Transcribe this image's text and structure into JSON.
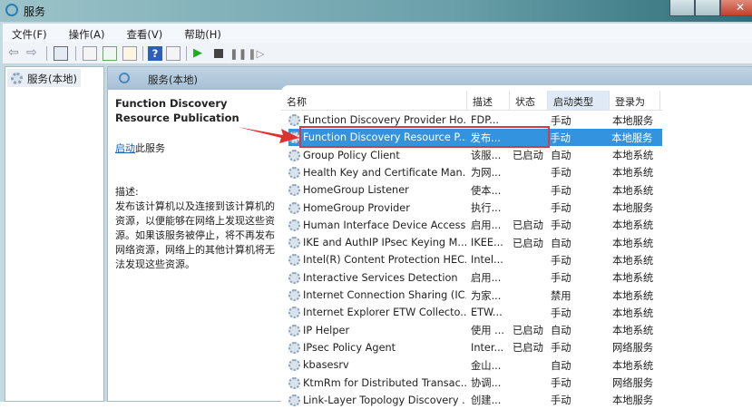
{
  "window": {
    "title": "服务",
    "close": "✕"
  },
  "menu": [
    "文件(F)",
    "操作(A)",
    "查看(V)",
    "帮助(H)"
  ],
  "tree": {
    "root": "服务(本地)"
  },
  "header": {
    "title": "服务(本地)"
  },
  "details": {
    "title": "Function Discovery Resource Publication",
    "start_link": "启动",
    "start_suffix": "此服务",
    "desc_label": "描述:",
    "desc_text": "发布该计算机以及连接到该计算机的资源，以便能够在网络上发现这些资源。如果该服务被停止，将不再发布网络资源，网络上的其他计算机将无法发现这些资源。"
  },
  "columns": [
    "名称",
    "描述",
    "状态",
    "启动类型",
    "登录为"
  ],
  "rows": [
    {
      "name": "Function Discovery Provider Ho...",
      "desc": "FDP...",
      "status": "",
      "startup": "手动",
      "logon": "本地服务"
    },
    {
      "name": "Function Discovery Resource P...",
      "desc": "发布...",
      "status": "",
      "startup": "手动",
      "logon": "本地服务",
      "selected": true
    },
    {
      "name": "Group Policy Client",
      "desc": "该服...",
      "status": "已启动",
      "startup": "自动",
      "logon": "本地系统"
    },
    {
      "name": "Health Key and Certificate Man...",
      "desc": "为网...",
      "status": "",
      "startup": "手动",
      "logon": "本地系统"
    },
    {
      "name": "HomeGroup Listener",
      "desc": "使本...",
      "status": "",
      "startup": "手动",
      "logon": "本地系统"
    },
    {
      "name": "HomeGroup Provider",
      "desc": "执行...",
      "status": "",
      "startup": "手动",
      "logon": "本地服务"
    },
    {
      "name": "Human Interface Device Access",
      "desc": "启用...",
      "status": "已启动",
      "startup": "手动",
      "logon": "本地系统"
    },
    {
      "name": "IKE and AuthIP IPsec Keying M...",
      "desc": "IKEE...",
      "status": "已启动",
      "startup": "自动",
      "logon": "本地系统"
    },
    {
      "name": "Intel(R) Content Protection HEC...",
      "desc": "Intel...",
      "status": "",
      "startup": "手动",
      "logon": "本地系统"
    },
    {
      "name": "Interactive Services Detection",
      "desc": "启用...",
      "status": "",
      "startup": "手动",
      "logon": "本地系统"
    },
    {
      "name": "Internet Connection Sharing (IC...",
      "desc": "为家...",
      "status": "",
      "startup": "禁用",
      "logon": "本地系统"
    },
    {
      "name": "Internet Explorer ETW Collecto...",
      "desc": "ETW...",
      "status": "",
      "startup": "手动",
      "logon": "本地系统"
    },
    {
      "name": "IP Helper",
      "desc": "使用 ...",
      "status": "已启动",
      "startup": "自动",
      "logon": "本地系统"
    },
    {
      "name": "IPsec Policy Agent",
      "desc": "Inter...",
      "status": "已启动",
      "startup": "手动",
      "logon": "网络服务"
    },
    {
      "name": "kbasesrv",
      "desc": "金山...",
      "status": "",
      "startup": "自动",
      "logon": "本地系统"
    },
    {
      "name": "KtmRm for Distributed Transac...",
      "desc": "协调...",
      "status": "",
      "startup": "手动",
      "logon": "网络服务"
    },
    {
      "name": "Link-Layer Topology Discovery ...",
      "desc": "创建...",
      "status": "",
      "startup": "手动",
      "logon": "本地服务"
    }
  ]
}
